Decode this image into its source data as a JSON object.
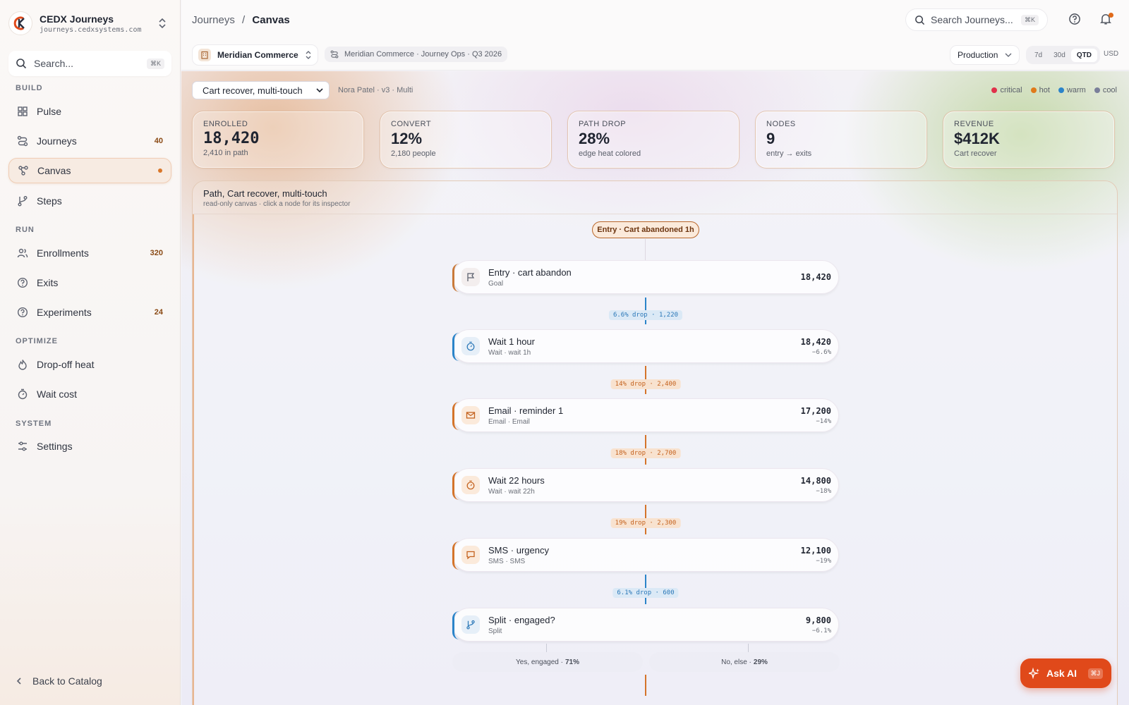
{
  "app": {
    "name": "CEDX Journeys",
    "url": "journeys.cedxsystems.com"
  },
  "sidebar": {
    "search_placeholder": "Search...",
    "search_kbd": "⌘K",
    "sections": {
      "build": "BUILD",
      "run": "RUN",
      "optimize": "OPTIMIZE",
      "system": "SYSTEM"
    },
    "items": {
      "pulse": {
        "label": "Pulse"
      },
      "journeys": {
        "label": "Journeys",
        "count": "40"
      },
      "canvas": {
        "label": "Canvas"
      },
      "steps": {
        "label": "Steps"
      },
      "enrollments": {
        "label": "Enrollments",
        "count": "320"
      },
      "exits": {
        "label": "Exits"
      },
      "experiments": {
        "label": "Experiments",
        "count": "24"
      },
      "dropoff": {
        "label": "Drop-off heat"
      },
      "waitcost": {
        "label": "Wait cost"
      },
      "settings": {
        "label": "Settings"
      }
    },
    "back_label": "Back to Catalog"
  },
  "topbar": {
    "breadcrumb_parent": "Journeys",
    "breadcrumb_sep": "/",
    "breadcrumb_current": "Canvas",
    "search_placeholder": "Search Journeys...",
    "search_kbd": "⌘K"
  },
  "subbar": {
    "workspace": "Meridian Commerce",
    "context": "Meridian Commerce · Journey Ops · Q3 2026",
    "environment": "Production",
    "ranges": [
      "7d",
      "30d",
      "QTD"
    ],
    "currency": "USD"
  },
  "journey": {
    "selected": "Cart recover, multi-touch",
    "owner_meta": "Nora Patel · v3 · Multi"
  },
  "legend": [
    {
      "label": "critical",
      "color": "#e0314a"
    },
    {
      "label": "hot",
      "color": "#e07a1a"
    },
    {
      "label": "warm",
      "color": "#2b84c9"
    },
    {
      "label": "cool",
      "color": "#7a7f9a"
    }
  ],
  "kpis": [
    {
      "label": "ENROLLED",
      "value": "18,420",
      "sub": "2,410 in path"
    },
    {
      "label": "CONVERT",
      "value": "12%",
      "sub": "2,180 people"
    },
    {
      "label": "PATH DROP",
      "value": "28%",
      "sub": "edge heat colored"
    },
    {
      "label": "NODES",
      "value": "9",
      "sub": "entry → exits"
    },
    {
      "label": "REVENUE",
      "value": "$412K",
      "sub": "Cart recover"
    }
  ],
  "path": {
    "title": "Path, Cart recover, multi-touch",
    "subtitle": "read-only canvas · click a node for its inspector",
    "entry_pill": "Entry · Cart abandoned 1h",
    "nodes": [
      {
        "title": "Entry · cart abandon",
        "sub": "Goal",
        "count": "18,420",
        "delta": "",
        "icon": "flag-icon"
      },
      {
        "title": "Wait 1 hour",
        "sub": "Wait · wait 1h",
        "count": "18,420",
        "delta": "−6.6%",
        "icon": "timer-icon"
      },
      {
        "title": "Email · reminder 1",
        "sub": "Email · Email",
        "count": "17,200",
        "delta": "−14%",
        "icon": "mail-icon"
      },
      {
        "title": "Wait 22 hours",
        "sub": "Wait · wait 22h",
        "count": "14,800",
        "delta": "−18%",
        "icon": "timer-icon"
      },
      {
        "title": "SMS · urgency",
        "sub": "SMS · SMS",
        "count": "12,100",
        "delta": "−19%",
        "icon": "message-icon"
      },
      {
        "title": "Split · engaged?",
        "sub": "Split",
        "count": "9,800",
        "delta": "−6.1%",
        "icon": "branch-icon"
      }
    ],
    "drops": [
      {
        "label": "6.6% drop · 1,220",
        "heat": "warm"
      },
      {
        "label": "14% drop · 2,400",
        "heat": "hot"
      },
      {
        "label": "18% drop · 2,700",
        "heat": "hot"
      },
      {
        "label": "19% drop · 2,300",
        "heat": "hot"
      },
      {
        "label": "6.1% drop · 600",
        "heat": "warm"
      }
    ],
    "branches": [
      {
        "label": "Yes, engaged ·",
        "pct": "71%"
      },
      {
        "label": "No, else ·",
        "pct": "29%"
      }
    ]
  },
  "ask_ai": {
    "label": "Ask AI",
    "kbd": "⌘J"
  }
}
